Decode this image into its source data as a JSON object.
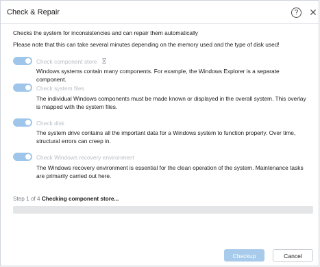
{
  "window": {
    "title": "Check & Repair",
    "help_glyph": "?",
    "close_glyph": "✕"
  },
  "intro": {
    "line1": "Checks the system for inconsistencies and can repair them automatically",
    "line2": "Please note that this can take several minutes depending on the memory used and the type of disk used!"
  },
  "checks": [
    {
      "label": "Check component store",
      "enabled": true,
      "description": "Windows systems contain many components. For example, the Windows Explorer is a separate component."
    },
    {
      "label": "Check system files",
      "enabled": true,
      "description": "The individual Windows components must be made known or displayed in the overall system. This overlay is mapped with the system files."
    },
    {
      "label": "Check disk",
      "enabled": true,
      "description": "The system drive contains all the important data for a Windows system to function properly. Over time, structural errors can creep in."
    },
    {
      "label": "Check Windows recovery environment",
      "enabled": true,
      "description": "The Windows recovery environment is essential for the clean operation of the system. Maintenance tasks are primarily carried out here."
    }
  ],
  "status": {
    "step_text": "Step 1 of 4",
    "status_text": "Checking component store...",
    "progress": 0
  },
  "buttons": {
    "checkup_label": "Checkup",
    "cancel_label": "Cancel"
  },
  "colors": {
    "accent": "#9fc6ea",
    "disabled_text": "#b9bec4"
  }
}
